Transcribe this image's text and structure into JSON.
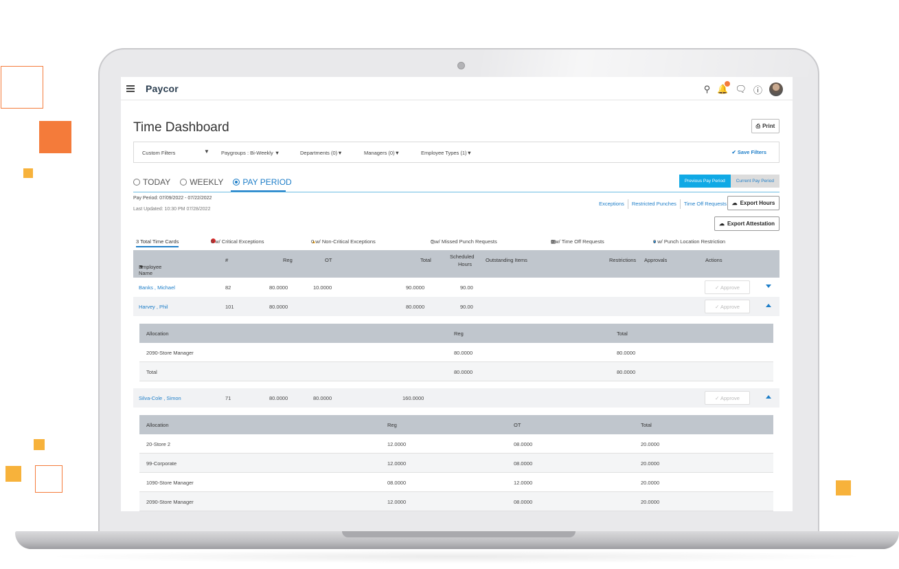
{
  "app": {
    "logo": "Paycor",
    "page_title": "Time Dashboard",
    "print_label": "Print",
    "notification_badge": ""
  },
  "filters": {
    "custom": "Custom Filters",
    "paygroups": "Paygroups : Bi-Weekly",
    "departments": "Departments (0)",
    "managers": "Managers (0)",
    "employee_types": "Employee Types (1)",
    "save": "Save Filters"
  },
  "tabs": [
    {
      "label": "TODAY",
      "active": false
    },
    {
      "label": "WEEKLY",
      "active": false
    },
    {
      "label": "PAY PERIOD",
      "active": true
    }
  ],
  "period_toggle": {
    "previous": "Previous Pay Period",
    "current": "Current Pay Period"
  },
  "pay_period": {
    "range": "Pay Period: 07/09/2022 - 07/22/2022",
    "updated": "Last Updated: 10:30 PM 07/28/2022"
  },
  "actions": {
    "exceptions": "Exceptions",
    "restricted_punches": "Restricted Punches",
    "time_off_requests": "Time Off Requests",
    "export_hours": "Export Hours",
    "export_attestation": "Export Attestation"
  },
  "summary": {
    "total_cards": "3 Total Time Cards",
    "critical": "0 w/ Critical Exceptions",
    "non_critical": "0 w/ Non-Critical Exceptions",
    "missed_punch": "0 w/ Missed Punch Requests",
    "time_off": "0 w/ Time Off Requests",
    "location": "0 w/ Punch Location Restriction"
  },
  "table": {
    "headers": {
      "name": "Employee Name",
      "num": "#",
      "reg": "Reg",
      "ot": "OT",
      "total": "Total",
      "scheduled_1": "Scheduled",
      "scheduled_2": "Hours",
      "outstanding": "Outstanding Items",
      "restrictions": "Restrictions",
      "approvals": "Approvals",
      "actions": "Actions"
    },
    "approve_label": "✓ Approve",
    "rows": [
      {
        "name": "Banks , Michael",
        "num": "82",
        "reg": "80.0000",
        "ot": "10.0000",
        "total": "90.0000",
        "scheduled": "90.00"
      },
      {
        "name": "Harvey , Phil",
        "num": "101",
        "reg": "80.0000",
        "ot": "",
        "total": "80.0000",
        "scheduled": "90.00"
      },
      {
        "name": "Silva-Cole , Simon",
        "num": "71",
        "reg": "80.0000",
        "ot": "80.0000",
        "total": "160.0000",
        "scheduled": ""
      }
    ]
  },
  "harvey_alloc": {
    "headers": {
      "allocation": "Allocation",
      "reg": "Reg",
      "total": "Total"
    },
    "rows": [
      {
        "allocation": "2090-Store Manager",
        "reg": "80.0000",
        "total": "80.0000"
      },
      {
        "allocation": "Total",
        "reg": "80.0000",
        "total": "80.0000"
      }
    ]
  },
  "silva_alloc": {
    "headers": {
      "allocation": "Allocation",
      "reg": "Reg",
      "ot": "OT",
      "total": "Total"
    },
    "rows": [
      {
        "allocation": "20-Store 2",
        "reg": "12.0000",
        "ot": "08.0000",
        "total": "20.0000"
      },
      {
        "allocation": "99-Corporate",
        "reg": "12.0000",
        "ot": "08.0000",
        "total": "20.0000"
      },
      {
        "allocation": "1090-Store Manager",
        "reg": "08.0000",
        "ot": "12.0000",
        "total": "20.0000"
      },
      {
        "allocation": "2090-Store Manager",
        "reg": "12.0000",
        "ot": "08.0000",
        "total": "20.0000"
      }
    ]
  },
  "colors": {
    "accent": "#1e7ec8",
    "brand_orange": "#f47b3a",
    "brand_yellow": "#f7b23b",
    "header_gray": "#c0c6cd"
  }
}
